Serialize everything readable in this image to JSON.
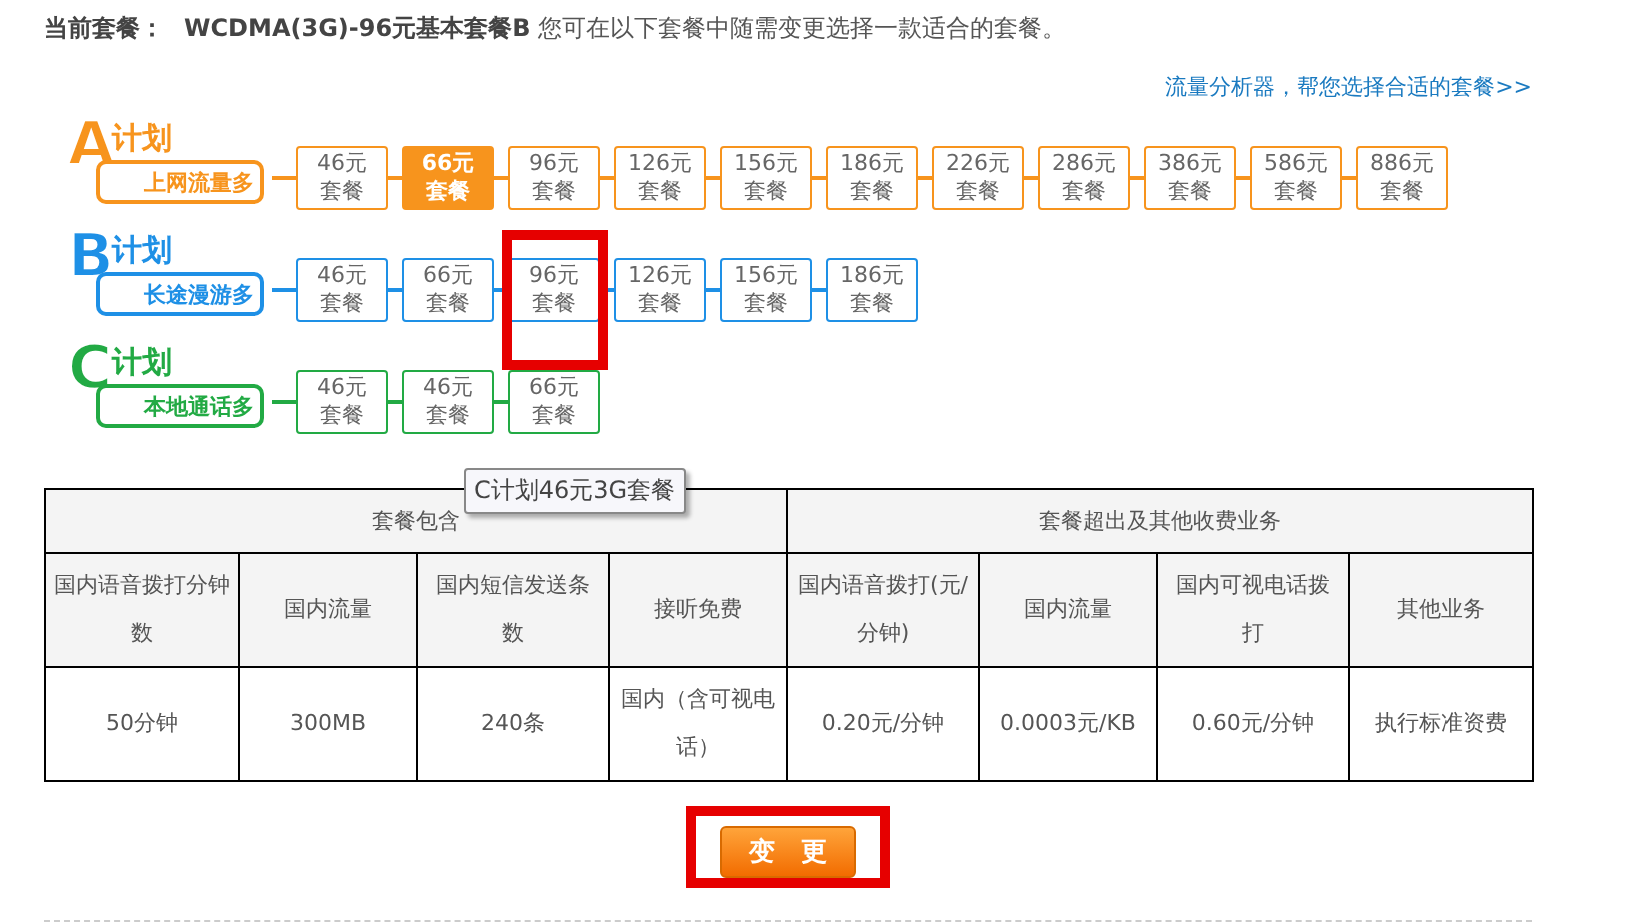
{
  "current_plan": {
    "label": "当前套餐：",
    "name": "WCDMA(3G)-96元基本套餐B",
    "note": "您可在以下套餐中随需变更选择一款适合的套餐。"
  },
  "analyzer_link": "流量分析器，帮您选择合适的套餐>>",
  "plans": [
    {
      "letter": "A",
      "title": "计划",
      "subtitle": "上网流量多",
      "color": "#f7941d",
      "packages": [
        {
          "price": "46元",
          "label": "套餐",
          "selected": false,
          "highlighted": false
        },
        {
          "price": "66元",
          "label": "套餐",
          "selected": true,
          "highlighted": false
        },
        {
          "price": "96元",
          "label": "套餐",
          "selected": false,
          "highlighted": false
        },
        {
          "price": "126元",
          "label": "套餐",
          "selected": false,
          "highlighted": false
        },
        {
          "price": "156元",
          "label": "套餐",
          "selected": false,
          "highlighted": false
        },
        {
          "price": "186元",
          "label": "套餐",
          "selected": false,
          "highlighted": false
        },
        {
          "price": "226元",
          "label": "套餐",
          "selected": false,
          "highlighted": false
        },
        {
          "price": "286元",
          "label": "套餐",
          "selected": false,
          "highlighted": false
        },
        {
          "price": "386元",
          "label": "套餐",
          "selected": false,
          "highlighted": false
        },
        {
          "price": "586元",
          "label": "套餐",
          "selected": false,
          "highlighted": false
        },
        {
          "price": "886元",
          "label": "套餐",
          "selected": false,
          "highlighted": false
        }
      ]
    },
    {
      "letter": "B",
      "title": "计划",
      "subtitle": "长途漫游多",
      "color": "#1e90e6",
      "packages": [
        {
          "price": "46元",
          "label": "套餐",
          "selected": false,
          "highlighted": false
        },
        {
          "price": "66元",
          "label": "套餐",
          "selected": false,
          "highlighted": false
        },
        {
          "price": "96元",
          "label": "套餐",
          "selected": false,
          "highlighted": true
        },
        {
          "price": "126元",
          "label": "套餐",
          "selected": false,
          "highlighted": false
        },
        {
          "price": "156元",
          "label": "套餐",
          "selected": false,
          "highlighted": false
        },
        {
          "price": "186元",
          "label": "套餐",
          "selected": false,
          "highlighted": false
        }
      ]
    },
    {
      "letter": "C",
      "title": "计划",
      "subtitle": "本地通话多",
      "color": "#22aa44",
      "packages": [
        {
          "price": "46元",
          "label": "套餐",
          "selected": false,
          "highlighted": false
        },
        {
          "price": "46元",
          "label": "套餐",
          "selected": false,
          "highlighted": false
        },
        {
          "price": "66元",
          "label": "套餐",
          "selected": false,
          "highlighted": false
        }
      ]
    }
  ],
  "tooltip": "C计划46元3G套餐",
  "table": {
    "groups": [
      {
        "label": "套餐包含"
      },
      {
        "label": "套餐超出及其他收费业务"
      }
    ],
    "columns": [
      "国内语音拨打分钟数",
      "国内流量",
      "国内短信发送条数",
      "接听免费",
      "国内语音拨打(元/分钟)",
      "国内流量",
      "国内可视电话拨打",
      "其他业务"
    ],
    "rows": [
      [
        "50分钟",
        "300MB",
        "240条",
        "国内（含可视电话）",
        "0.20元/分钟",
        "0.0003元/KB",
        "0.60元/分钟",
        "执行标准资费"
      ]
    ]
  },
  "change_button": {
    "label": "变　更",
    "highlighted": true
  }
}
